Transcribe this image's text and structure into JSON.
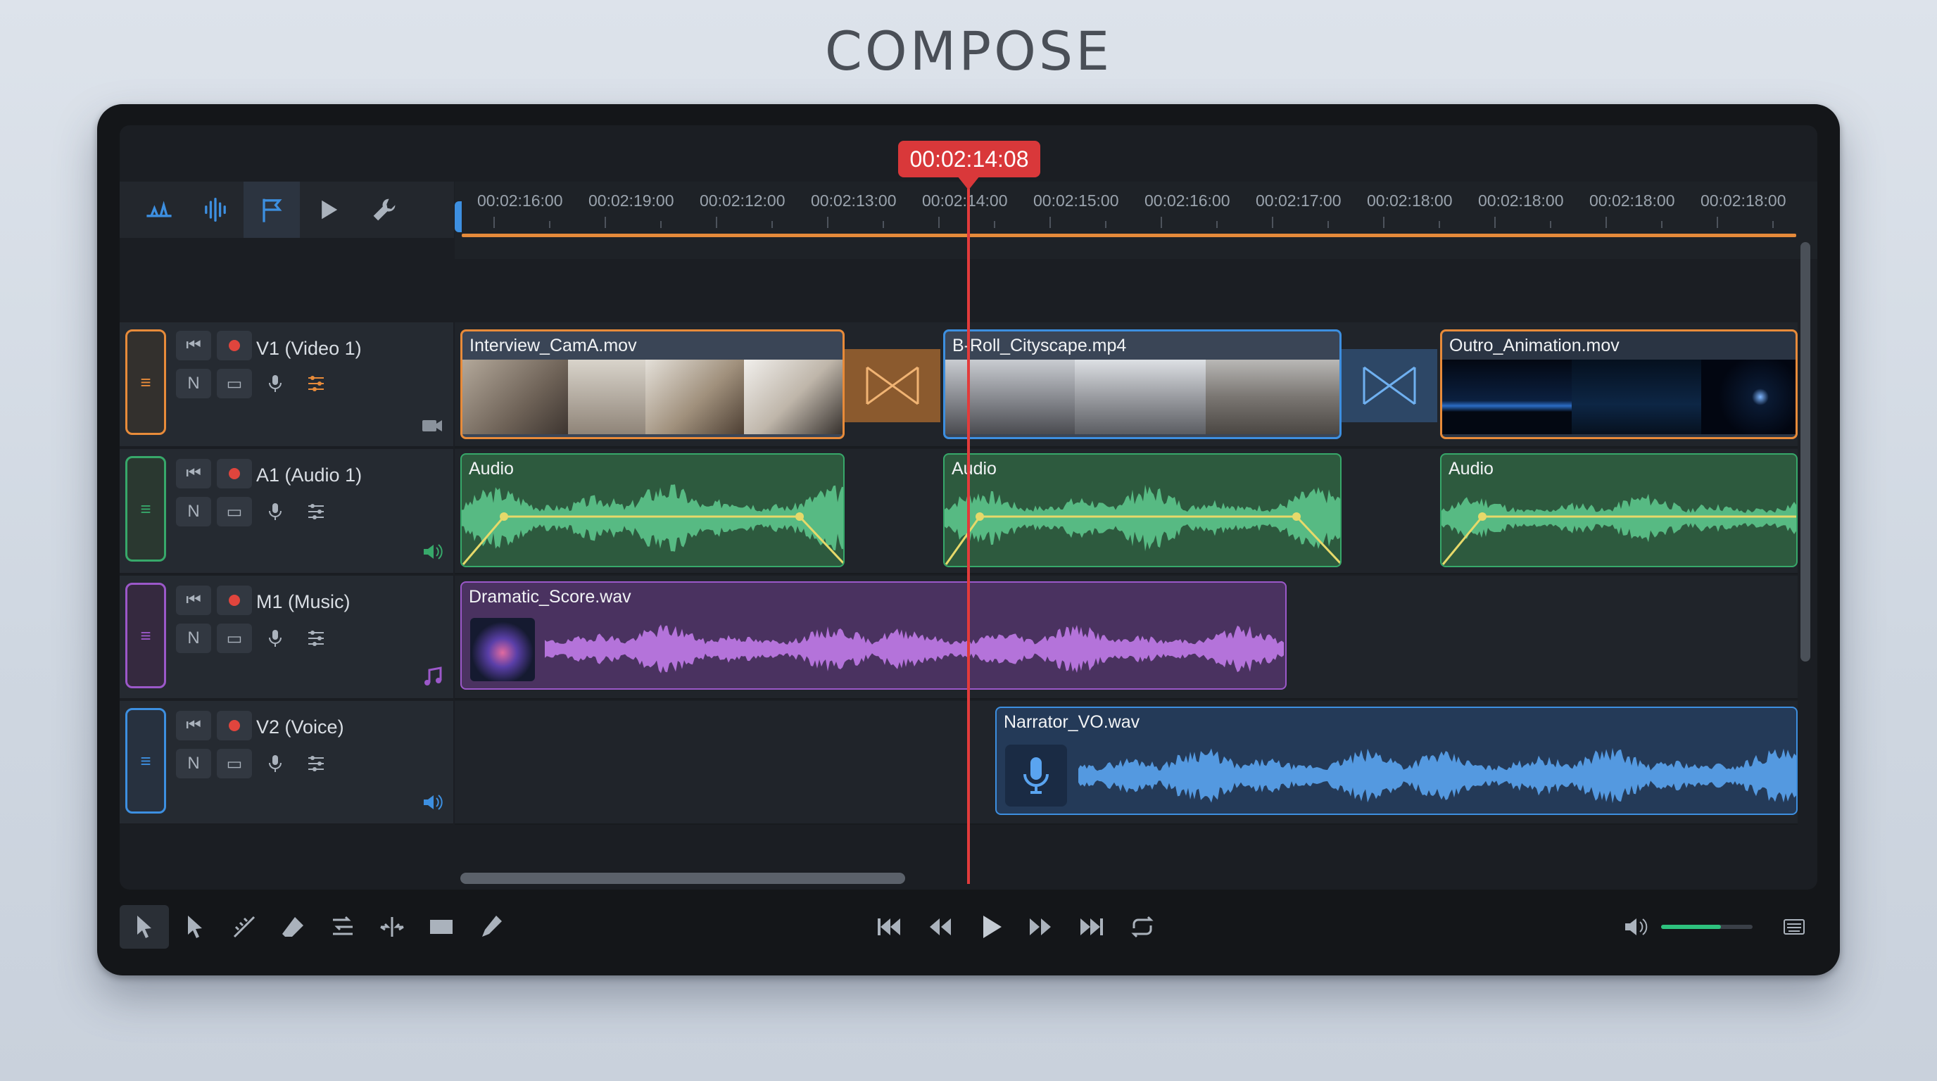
{
  "page": {
    "title": "COMPOSE"
  },
  "playhead": {
    "timecode": "00:02:14:08"
  },
  "ruler": {
    "labels": [
      "00:02:16:00",
      "00:02:19:00",
      "00:02:12:00",
      "00:02:13:00",
      "00:02:14:00",
      "00:02:15:00",
      "00:02:16:00",
      "00:02:17:00",
      "00:02:18:00",
      "00:02:18:00",
      "00:02:18:00",
      "00:02:18:00"
    ]
  },
  "top_toolbar": {
    "icons": [
      "waveform-split-icon",
      "audio-level-icon",
      "snap-icon",
      "play-icon",
      "wrench-icon"
    ]
  },
  "tracks": [
    {
      "name": "V1 (Video 1)",
      "color": "#e88b3a",
      "kind_icon": "camera-icon",
      "mute": "N"
    },
    {
      "name": "A1 (Audio 1)",
      "color": "#37a86a",
      "kind_icon": "speaker-icon",
      "mute": "N"
    },
    {
      "name": "M1 (Music)",
      "color": "#9b58c9",
      "kind_icon": "music-note-icon",
      "mute": "N"
    },
    {
      "name": "V2 (Voice)",
      "color": "#3d8fe0",
      "kind_icon": "speaker-icon",
      "mute": "N"
    }
  ],
  "clips": {
    "v1_a": "Interview_CamA.mov",
    "v1_b": "B-Roll_Cityscape.mp4",
    "v1_c": "Outro_Animation.mov",
    "a1_a": "Audio",
    "a1_b": "Audio",
    "a1_c": "Audio",
    "m1_a": "Dramatic_Score.wav",
    "v2_a": "Narrator_VO.wav"
  },
  "colors": {
    "video": "#e88b3a",
    "audio": "#37a86a",
    "music": "#9b58c9",
    "voice": "#3d8fe0",
    "playhead": "#d9383a"
  },
  "bottom_tools": [
    "select-tool-icon",
    "arrow-tool-icon",
    "razor-tool-icon",
    "eraser-tool-icon",
    "ripple-tool-icon",
    "trim-tool-icon",
    "slip-tool-icon",
    "pen-tool-icon"
  ],
  "transport": [
    "skip-start-icon",
    "rewind-icon",
    "play-icon",
    "fast-forward-icon",
    "skip-end-icon",
    "loop-icon"
  ],
  "volume": {
    "level": 0.65
  }
}
